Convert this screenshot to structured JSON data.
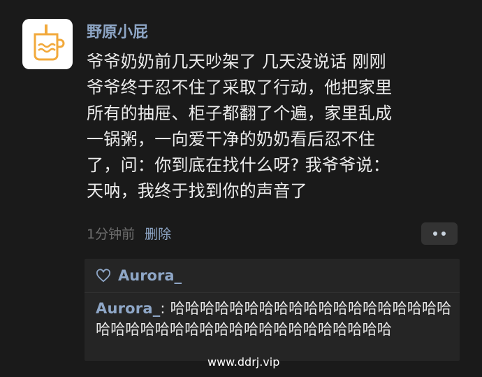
{
  "post": {
    "username": "野原小屁",
    "text": "爷爷奶奶前几天吵架了 几天没说话 刚刚\n爷爷终于忍不住了采取了行动，他把家里\n所有的抽屉、柜子都翻了个遍，家里乱成\n一锅粥，一向爱干净的奶奶看后忍不住\n了，问：你到底在找什么呀? 我爷爷说：\n天呐，我终于找到你的声音了",
    "time": "1分钟前",
    "delete_label": "删除"
  },
  "comments": {
    "liked_by": "Aurora_",
    "items": [
      {
        "author": "Aurora_",
        "separator": ": ",
        "text": "哈哈哈哈哈哈哈哈哈哈哈哈哈哈哈哈哈哈哈哈哈哈哈哈哈哈哈哈哈哈哈哈哈哈哈哈哈哈哈"
      }
    ]
  },
  "watermark": "www.ddrj.vip",
  "colors": {
    "background": "#1a1a1a",
    "accent_name": "#8ea6c6",
    "comment_bg": "#252525"
  },
  "icons": {
    "avatar": "cup-icon",
    "like": "heart-outline-icon",
    "more": "more-dots-icon"
  }
}
